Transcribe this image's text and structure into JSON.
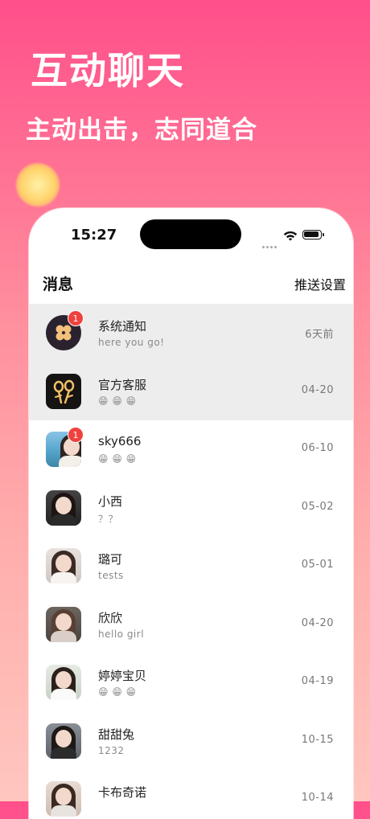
{
  "promo": {
    "headline": "互动聊天",
    "subline": "主动出击，志同道合"
  },
  "status_bar": {
    "time": "15:27"
  },
  "header": {
    "title": "消息",
    "action": "推送设置"
  },
  "conversations": [
    {
      "name": "系统通知",
      "preview": "here you go!",
      "date": "6天前",
      "badge": "1",
      "avatar": "system-notice-icon"
    },
    {
      "name": "官方客服",
      "preview": "😁 😁 😁",
      "date": "04-20",
      "avatar": "customer-service-icon"
    },
    {
      "name": "sky666",
      "preview": "😁 😁 😁",
      "date": "06-10",
      "badge": "1",
      "avatar": "user-photo"
    },
    {
      "name": "小西",
      "preview": "？？",
      "date": "05-02",
      "avatar": "user-photo"
    },
    {
      "name": "璐可",
      "preview": "tests",
      "date": "05-01",
      "avatar": "user-photo"
    },
    {
      "name": "欣欣",
      "preview": "hello girl",
      "date": "04-20",
      "avatar": "user-photo"
    },
    {
      "name": "婷婷宝贝",
      "preview": "😁 😁 😁",
      "date": "04-19",
      "avatar": "user-photo"
    },
    {
      "name": "甜甜兔",
      "preview": "1232",
      "date": "10-15",
      "avatar": "user-photo"
    },
    {
      "name": "卡布奇诺",
      "preview": "",
      "date": "10-14",
      "avatar": "user-photo"
    }
  ],
  "colors": {
    "gradient_top": "#ff4f8b",
    "gradient_bottom": "#ffc6bf",
    "badge": "#f0413d",
    "highlight_row": "#ededed"
  }
}
